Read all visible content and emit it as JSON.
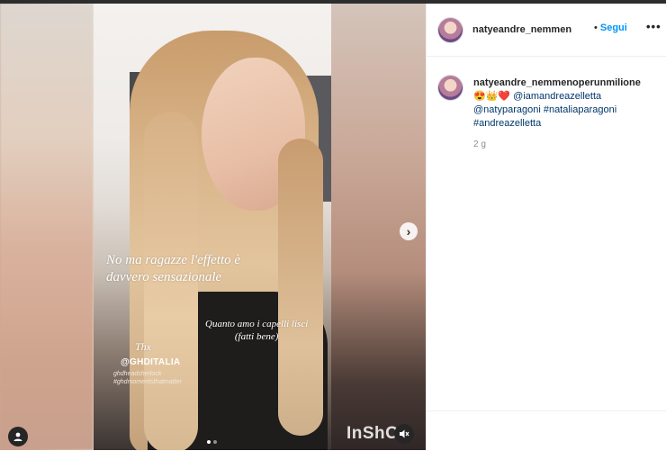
{
  "post": {
    "username": "natyeandre_nemmenoperu",
    "follow_separator": "•",
    "follow_label": "Segui",
    "more_label": "•••"
  },
  "caption": {
    "username": "natyeandre_nemmenoperunmilione",
    "emojis": "😍👑❤️",
    "mention_1": "@iamandreazelletta",
    "line_2": "@natyparagoni #nataliaparagoni",
    "line_3": "#andreazelletta",
    "time": "2 g"
  },
  "story_overlay": {
    "line_1": "No ma ragazze l'effetto è",
    "line_2": "davvero sensazionale",
    "quote_1": "Quanto amo i capelli lisci",
    "quote_2": "(fatti bene)",
    "thx": "Thx",
    "brand_tag": "@GHDITALIA",
    "small_1": "ghdheadsherlock",
    "small_2": "#ghdmomentsthatmatter",
    "watermark": "InShOt"
  },
  "icons": {
    "next": "chevron-right-icon",
    "user": "user-icon",
    "mute": "speaker-muted-icon",
    "more": "more-horizontal-icon"
  },
  "carousel": {
    "total_slides": 2,
    "active_index": 0
  },
  "colors": {
    "link": "#00376b",
    "follow": "#0095f6",
    "meta": "#8e8e8e"
  }
}
